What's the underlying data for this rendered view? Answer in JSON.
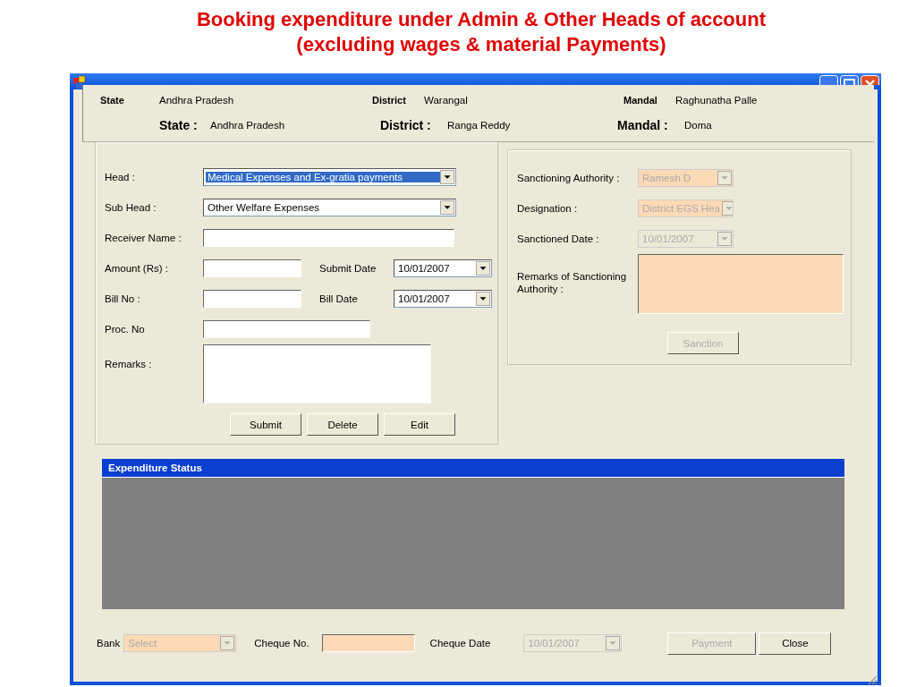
{
  "slide_title": [
    "Booking expenditure under Admin & Other Heads of account",
    "(excluding wages & material Payments)"
  ],
  "location": [
    {
      "kind": "small",
      "items": [
        {
          "label": "State",
          "value": "Andhra Pradesh"
        },
        {
          "label": "District",
          "value": "Warangal"
        },
        {
          "label": "Mandal",
          "value": "Raghunatha Palle"
        }
      ]
    },
    {
      "kind": "large",
      "items": [
        {
          "label": "State :",
          "value": "Andhra Pradesh"
        },
        {
          "label": "District :",
          "value": "Ranga Reddy"
        },
        {
          "label": "Mandal :",
          "value": "Doma"
        }
      ]
    }
  ],
  "entry": {
    "head": {
      "label": "Head :",
      "value": "Medical Expenses and Ex-gratia payments",
      "highlighted": true
    },
    "sub_head": {
      "label": "Sub Head :",
      "value": "Other Welfare Expenses",
      "highlighted": false
    },
    "receiver_name": {
      "label": "Receiver Name :"
    },
    "amount": {
      "label": "Amount (Rs) :"
    },
    "submit_date": {
      "label": "Submit Date",
      "value": "10/01/2007"
    },
    "bill_no": {
      "label": "Bill No :"
    },
    "bill_date": {
      "label": "Bill Date",
      "value": "10/01/2007"
    },
    "proc_no": {
      "label": "Proc. No"
    },
    "remarks": {
      "label": "Remarks :"
    },
    "buttons": [
      "Submit",
      "Delete",
      "Edit"
    ]
  },
  "sanction": {
    "fields": [
      {
        "kind": "combo",
        "label": "Sanctioning Authority :",
        "value": "Ramesh D",
        "disabled": true
      },
      {
        "kind": "combo",
        "label": "Designation :",
        "value": "District EGS Hea",
        "disabled": true
      },
      {
        "kind": "date",
        "label": "Sanctioned Date :",
        "value": "10/01/2007",
        "disabled": true
      }
    ],
    "remarks": {
      "label": "Remarks of Sanctioning Authority :",
      "disabled": true
    },
    "button": {
      "label": "Sanction",
      "disabled": true
    }
  },
  "status": {
    "title": "Expenditure Status"
  },
  "footer": {
    "bank": {
      "label": "Bank",
      "value": "Select",
      "disabled": true
    },
    "cheque_no": {
      "label": "Cheque No.",
      "disabled": true
    },
    "cheque_date": {
      "label": "Cheque Date",
      "value": "10/01/2007",
      "disabled": true
    },
    "buttons": [
      {
        "label": "Payment",
        "disabled": true
      },
      {
        "label": "Close",
        "disabled": false
      }
    ]
  }
}
